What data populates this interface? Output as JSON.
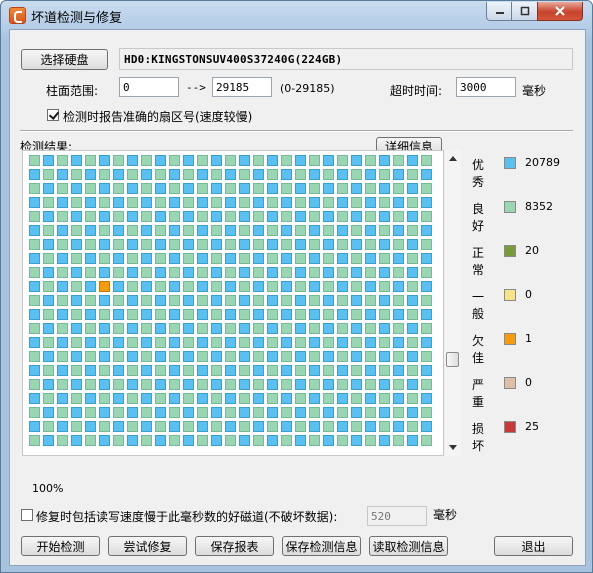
{
  "window": {
    "title": "坏道检测与修复"
  },
  "drive": {
    "select_label": "选择硬盘",
    "selected": "HD0:KINGSTONSUV400S37240G(224GB)"
  },
  "range": {
    "label": "柱面范围:",
    "start": "0",
    "arrow": "-->",
    "end": "29185",
    "hint": "(0-29185)"
  },
  "timeout": {
    "label": "超时时间:",
    "value": "3000",
    "unit": "毫秒"
  },
  "report_sector": {
    "checked": true,
    "label": "检测时报告准确的扇区号(速度较慢)"
  },
  "results": {
    "label": "检测结果:",
    "details_label": "详细信息",
    "progress": "100%"
  },
  "legend": [
    {
      "name": "优秀",
      "count": "20789",
      "color": "#5bc0f0"
    },
    {
      "name": "良好",
      "count": "8352",
      "color": "#9ad6b4"
    },
    {
      "name": "正常",
      "count": "20",
      "color": "#7a9a3a"
    },
    {
      "name": "一般",
      "count": "0",
      "color": "#f7e38a"
    },
    {
      "name": "欠佳",
      "count": "1",
      "color": "#f59b12"
    },
    {
      "name": "严重",
      "count": "0",
      "color": "#dcbfa6"
    },
    {
      "name": "损坏",
      "count": "25",
      "color": "#c8373a"
    }
  ],
  "grid": {
    "cols": 29,
    "rows": 21,
    "highlight_row": 9,
    "highlight_col": 5
  },
  "repair_option": {
    "checked": false,
    "label": "修复时包括读写速度慢于此毫秒数的好磁道(不破坏数据):",
    "value": "520",
    "unit": "毫秒"
  },
  "buttons": {
    "start": "开始检测",
    "try_repair": "尝试修复",
    "save_report": "保存报表",
    "save_info": "保存检测信息",
    "load_info": "读取检测信息",
    "exit": "退出"
  }
}
